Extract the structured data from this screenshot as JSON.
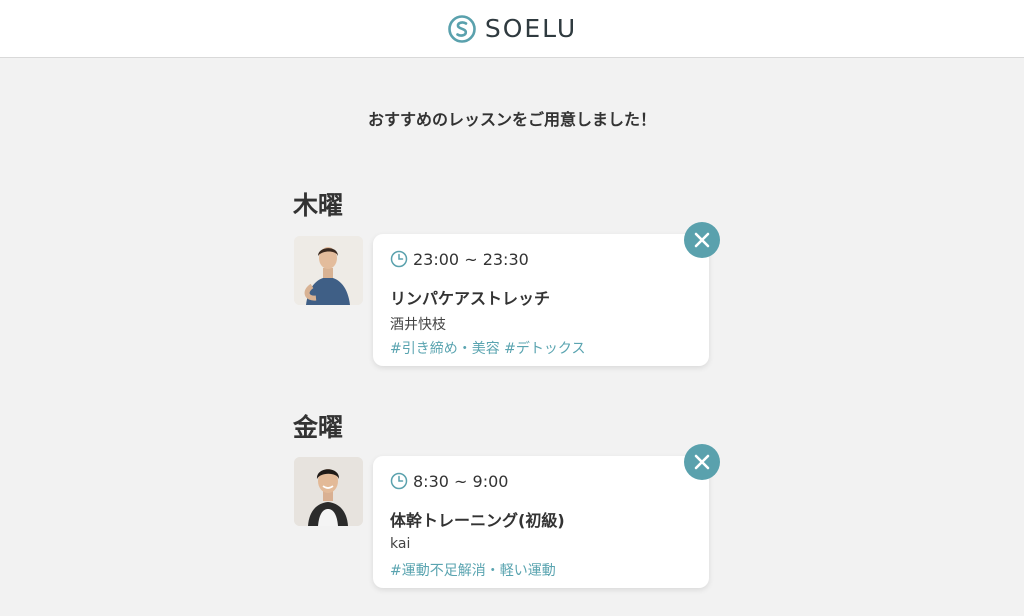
{
  "brand": {
    "name": "SOELU",
    "accent": "#5aa1ad"
  },
  "intro": "おすすめのレッスンをご用意しました！",
  "days": [
    {
      "day": "木曜",
      "lesson": {
        "time": "23:00 ~ 23:30",
        "title": "リンパケアストレッチ",
        "instructor": "酒井快枝",
        "tags": "#引き締め・美容 #デトックス"
      }
    },
    {
      "day": "金曜",
      "lesson": {
        "time": "8:30 ~ 9:00",
        "title": "体幹トレーニング(初級)",
        "instructor": "kai",
        "tags": "#運動不足解消・軽い運動"
      }
    }
  ]
}
